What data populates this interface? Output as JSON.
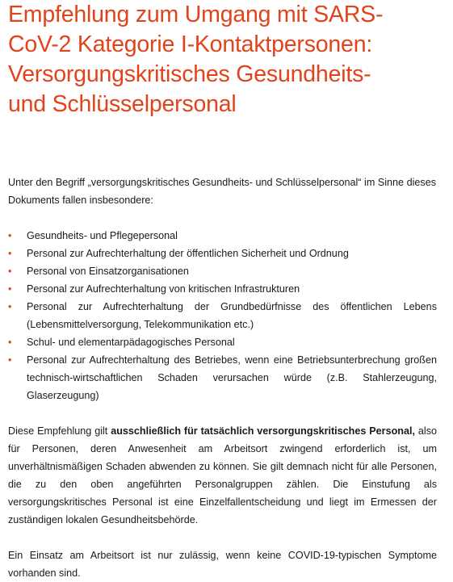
{
  "title_lines": [
    "Empfehlung zum Umgang mit SARS-",
    "CoV-2 Kategorie I-Kontaktpersonen:",
    "Versorgungskritisches Gesundheits-",
    "und Schlüsselpersonal"
  ],
  "intro": "Unter den Begriff „versorgungskritisches Gesundheits- und Schlüsselpersonal“ im Sinne dieses Dokuments fallen insbesondere:",
  "bullet_symbol": "•",
  "bullets": [
    "Gesundheits- und Pflegepersonal",
    "Personal zur Aufrechterhaltung der öffentlichen Sicherheit und Ordnung",
    "Personal von Einsatzorganisationen",
    "Personal zur Aufrechterhaltung von kritischen Infrastrukturen",
    "Personal zur Aufrechterhaltung der Grundbedürfnisse des öffentlichen Lebens (Lebensmittelversorgung, Telekommunikation etc.)",
    "Schul- und elementarpädagogisches Personal",
    "Personal zur Aufrechterhaltung des Betriebes, wenn eine Betriebsunterbrechung großen technisch-wirtschaftlichen Schaden verursachen würde (z.B. Stahlerzeugung, Glaserzeugung)"
  ],
  "paragraph1": {
    "before": "Diese Empfehlung gilt ",
    "bold": "ausschließlich für tatsächlich versorgungskritisches Personal,",
    "after": " also für Personen, deren Anwesenheit am Arbeitsort zwingend erforderlich ist, um unverhältnismäßigen Schaden abwenden zu können. Sie gilt demnach nicht für alle Personen, die zu den oben angeführten Personalgruppen zählen. Die Einstufung als versorgungskritisches Personal ist eine Einzelfallentscheidung und liegt im Ermessen der zuständigen lokalen Gesundheitsbehörde."
  },
  "paragraph2": "Ein Einsatz am Arbeitsort ist nur zulässig, wenn keine COVID-19-typischen Symptome vorhanden sind.",
  "colors": {
    "accent": "#e2431b",
    "text": "#1a1a1a"
  }
}
